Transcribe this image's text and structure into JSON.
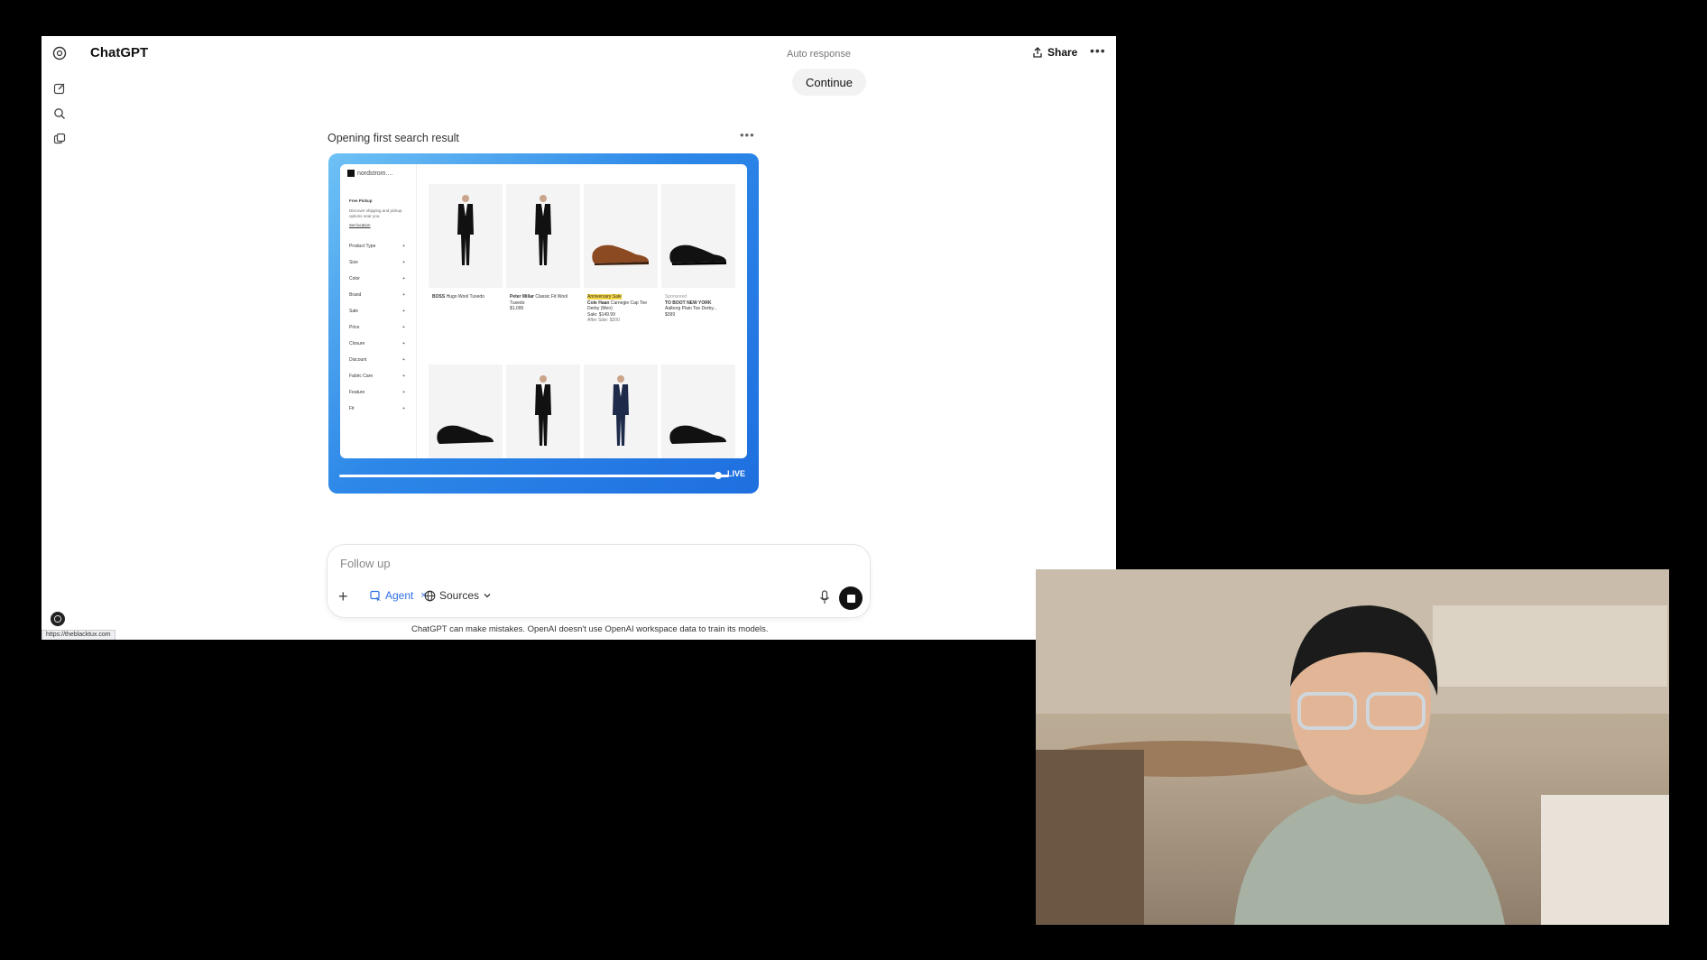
{
  "app": {
    "title": "ChatGPT",
    "auto_response_label": "Auto response",
    "continue_label": "Continue",
    "share_label": "Share",
    "more_icon": "ellipsis-icon"
  },
  "rail": {
    "icons": [
      "openai-logo-icon",
      "new-chat-icon",
      "search-icon",
      "library-icon"
    ]
  },
  "task": {
    "title": "Opening first search result",
    "live_label": "LIVE"
  },
  "browser": {
    "store_name": "nordstrom....",
    "free_pickup_label": "Free Pickup",
    "pickup_text": "Discover shipping and pickup options near you.",
    "set_location_label": "Set location",
    "filters": [
      "Product Type",
      "Size",
      "Color",
      "Brand",
      "Sale",
      "Price",
      "Closure",
      "Discount",
      "Fabric Care",
      "Feature",
      "Fit"
    ],
    "products": [
      {
        "brand": "BOSS",
        "name": "Hugo Wool Tuxedo",
        "price": ""
      },
      {
        "brand": "Peter Millar",
        "name": "Classic Fit Wool Tuxedo",
        "price": "$1,095"
      },
      {
        "brand": "Cole Haan",
        "name": "Carnegie Cap Toe Derby (Men)",
        "badge": "Anniversary Sale",
        "price": "Sale: $149.99",
        "price_after": "After Sale: $200"
      },
      {
        "brand": "TO BOOT NEW YORK",
        "name": "Aalborg Plain Toe Derby...",
        "sponsored": "Sponsored",
        "price": "$399"
      }
    ]
  },
  "composer": {
    "placeholder": "Follow up",
    "agent_label": "Agent",
    "sources_label": "Sources"
  },
  "disclaimer": "ChatGPT can make mistakes. OpenAI doesn't use OpenAI workspace data to train its models.",
  "status_url": "https://theblacktux.com"
}
